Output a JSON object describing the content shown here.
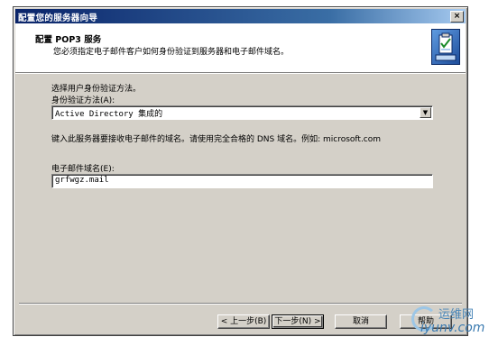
{
  "window": {
    "title": "配置您的服务器向导",
    "close_glyph": "×"
  },
  "header": {
    "title": "配置 POP3 服务",
    "subtitle": "您必须指定电子邮件客户如何身份验证到服务器和电子邮件域名。",
    "icon": "wizard-clipboard-icon"
  },
  "body": {
    "instruction": "选择用户身份验证方法。",
    "auth_label": "身份验证方法(A):",
    "auth_value": "Active Directory 集成的",
    "domain_hint": "键入此服务器要接收电子邮件的域名。请使用完全合格的 DNS 域名。例如: microsoft.com",
    "domain_label": "电子邮件域名(E):",
    "domain_value": "grfwgz.mail"
  },
  "buttons": {
    "back": "< 上一步(B)",
    "next": "下一步(N) >",
    "cancel": "取消",
    "help": "帮助"
  },
  "watermark": {
    "line1": "运维网",
    "line2": "iyunv.com"
  },
  "colors": {
    "dialog_face": "#d4d0c8",
    "title_active": "#0a246a",
    "title_gradient_end": "#a6caf0"
  }
}
